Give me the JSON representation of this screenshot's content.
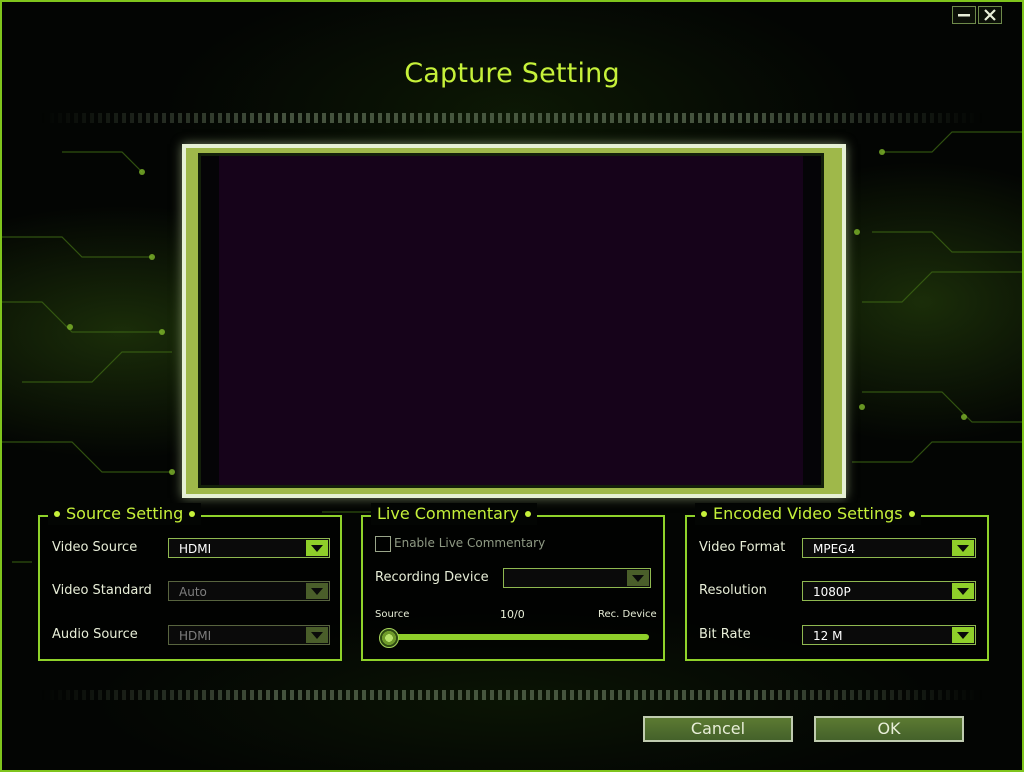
{
  "window": {
    "title": "Capture Setting",
    "minimize_icon": "minimize-icon",
    "close_icon": "close-icon"
  },
  "source_setting": {
    "title": "Source Setting",
    "video_source_label": "Video Source",
    "video_source_value": "HDMI",
    "video_standard_label": "Video Standard",
    "video_standard_value": "Auto",
    "audio_source_label": "Audio Source",
    "audio_source_value": "HDMI"
  },
  "live_commentary": {
    "title": "Live Commentary",
    "enable_label": "Enable Live Commentary",
    "enable_checked": false,
    "recording_device_label": "Recording Device",
    "recording_device_value": "",
    "mix_left_label": "Source",
    "mix_value_label": "10/0",
    "mix_right_label": "Rec. Device",
    "mix_position": 0
  },
  "encoded_video": {
    "title": "Encoded Video Settings",
    "format_label": "Video Format",
    "format_value": "MPEG4",
    "resolution_label": "Resolution",
    "resolution_value": "1080P",
    "bitrate_label": "Bit Rate",
    "bitrate_value": "12 M"
  },
  "buttons": {
    "cancel": "Cancel",
    "ok": "OK"
  },
  "colors": {
    "accent": "#c6f13a",
    "border": "#8fd22a",
    "button": "#5c7a32"
  }
}
